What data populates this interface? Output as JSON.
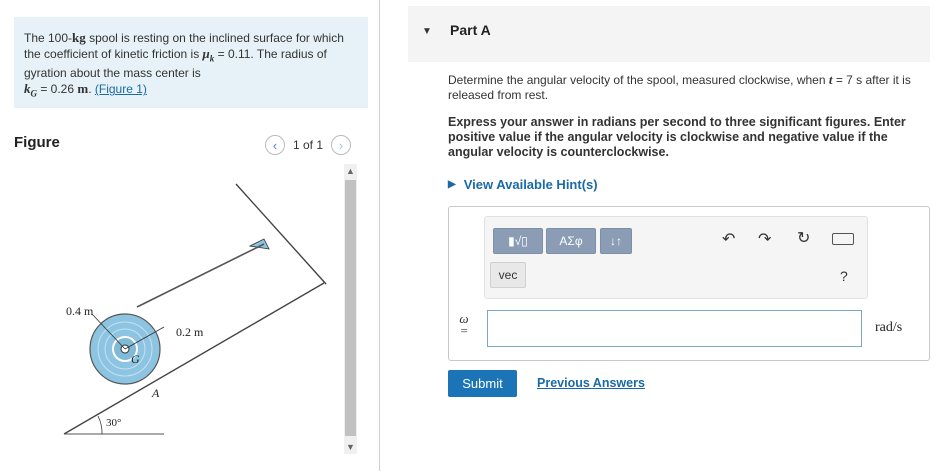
{
  "problem": {
    "text_1": "The 100-",
    "mass": "kg",
    "text_2": " spool is resting on the inclined surface for which the coefficient of kinetic friction is ",
    "mu_symbol": "μ",
    "mu_sub": "k",
    "mu_value": " = 0.11. The radius of gyration about the mass center is",
    "kg_symbol": "k",
    "kg_sub": "G",
    "kg_value": " = 0.26 ",
    "kg_unit": "m",
    "period": ". ",
    "figure_link": "(Figure 1)"
  },
  "figure": {
    "title": "Figure",
    "pager_text": "1 of 1",
    "prev_icon": "chevron-left-icon",
    "next_icon": "chevron-right-icon",
    "label_outer_radius": "0.4 m",
    "label_inner_radius": "0.2 m",
    "label_center": "G",
    "label_contact": "A",
    "label_angle": "30°",
    "spool_color": "#8cc4e2",
    "incline_color": "#444444"
  },
  "part": {
    "title": "Part A",
    "question_1": "Determine the angular velocity of the spool, measured clockwise, when ",
    "question_t": "t",
    "question_2": " = 7 s after it is released from rest.",
    "instructions": "Express your answer in radians per second to three significant figures. Enter positive value if the angular velocity is clockwise and negative value if the angular velocity is counterclockwise.",
    "hint_link": "View Available Hint(s)"
  },
  "toolbar": {
    "templates_label": "▮√▯",
    "greek_label": "ΑΣφ",
    "arrows_label": "↓↑",
    "vec_label": "vec",
    "undo_icon": "undo-icon",
    "redo_icon": "redo-icon",
    "reset_icon": "reset-icon",
    "keyboard_icon": "keyboard-icon",
    "help_label": "?"
  },
  "answer": {
    "variable": "ω",
    "equals": "=",
    "value": "",
    "unit": "rad/s"
  },
  "actions": {
    "submit_label": "Submit",
    "previous_answers_label": "Previous Answers"
  },
  "colors": {
    "accent": "#1b74b6",
    "link": "#1a6aa6",
    "problem_bg": "#e6f2f7"
  }
}
